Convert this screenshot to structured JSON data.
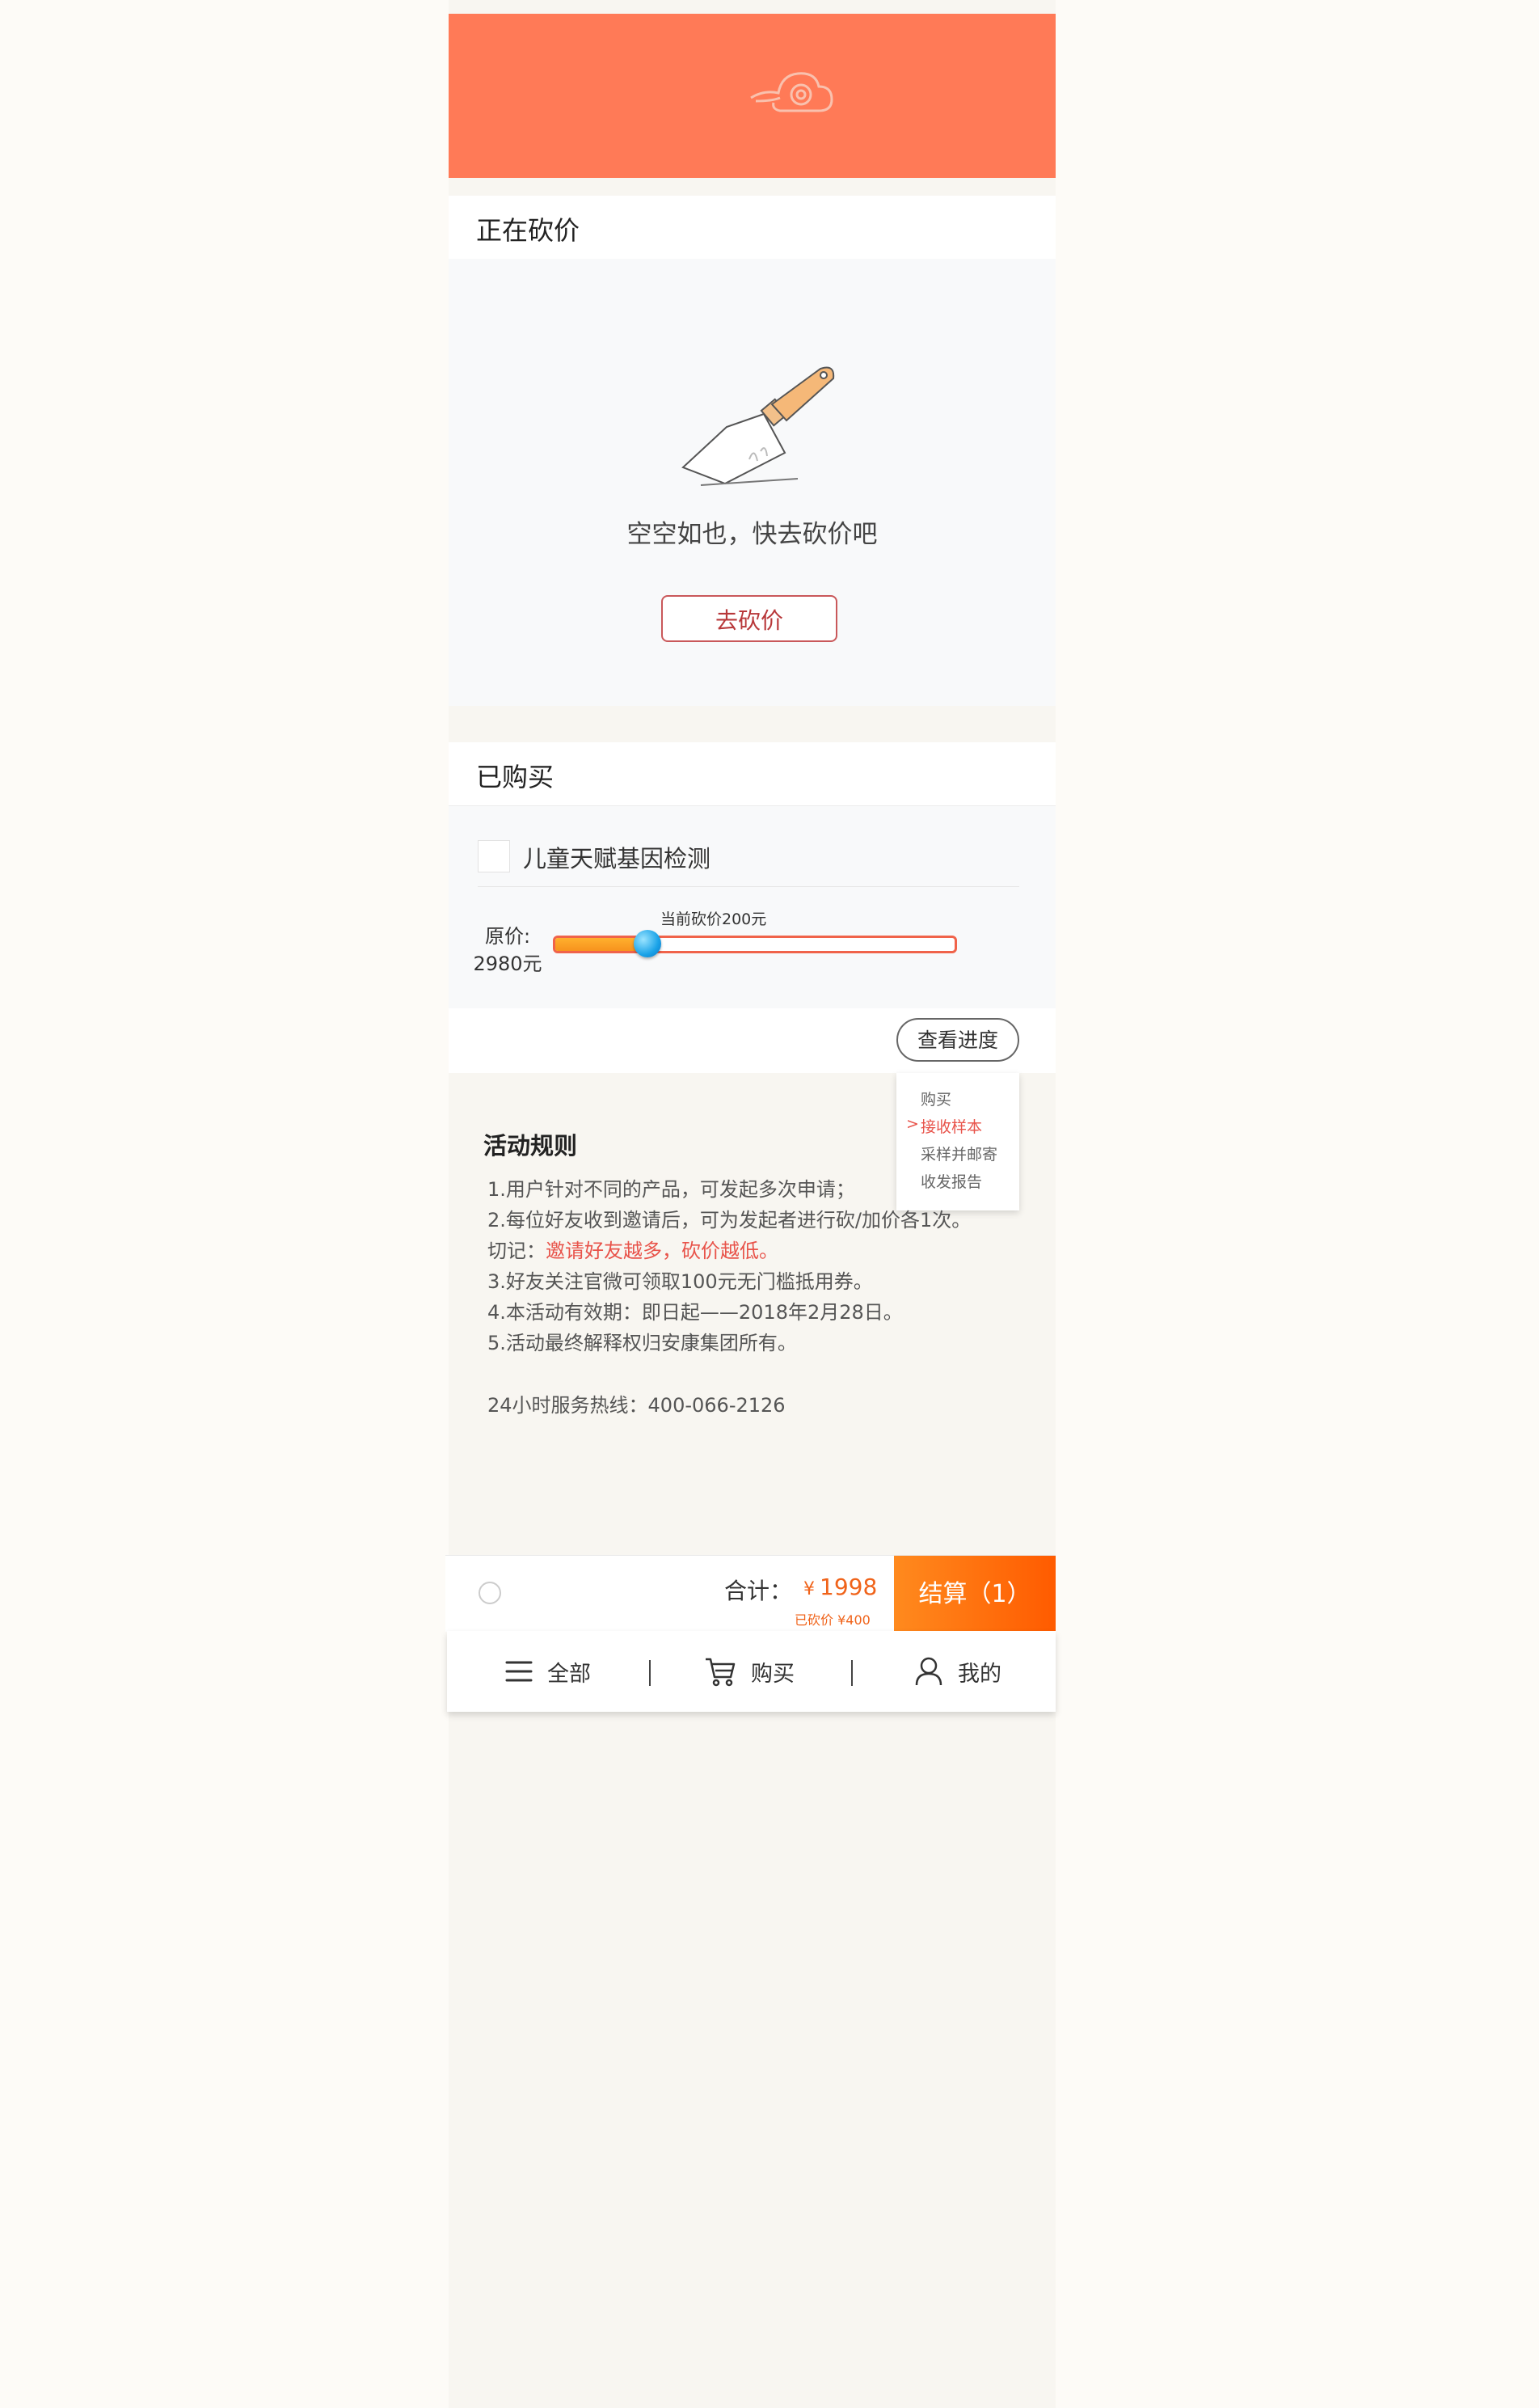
{
  "bargaining": {
    "title": "正在砍价",
    "empty_text": "空空如也，快去砍价吧",
    "go_button": "去砍价"
  },
  "purchased": {
    "title": "已购买",
    "product_name": "儿童天赋基因检测",
    "original_price_label": "原价:",
    "original_price": "2980元",
    "current_cut_label": "当前砍价200元",
    "progress_fraction": 0.23,
    "view_progress_button": "查看进度",
    "progress_steps": [
      {
        "label": "购买",
        "active": false
      },
      {
        "label": "接收样本",
        "active": true
      },
      {
        "label": "采样并邮寄",
        "active": false
      },
      {
        "label": "收发报告",
        "active": false
      }
    ],
    "active_marker": ">"
  },
  "rules": {
    "title": "活动规则",
    "line1": "1.用户针对不同的产品，可发起多次申请；",
    "line2": "2.每位好友收到邀请后，可为发起者进行砍/加价各1次。",
    "line3_prefix": "切记：",
    "line3_warn": "邀请好友越多，砍价越低。",
    "line4": "3.好友关注官微可领取100元无门槛抵用券。",
    "line5": "4.本活动有效期：即日起——2018年2月28日。",
    "line6": "5.活动最终解释权归安康集团所有。",
    "hotline": "24小时服务热线：400-066-2126"
  },
  "checkout": {
    "total_label": "合计：",
    "currency": "¥",
    "total_amount": "1998",
    "cut_text": "已砍价 ¥400",
    "button": "结算（1）"
  },
  "nav": {
    "all": "全部",
    "buy": "购买",
    "mine": "我的"
  },
  "colors": {
    "banner": "#ff7a57",
    "accent": "#f0631a",
    "warn": "#e8534a"
  }
}
